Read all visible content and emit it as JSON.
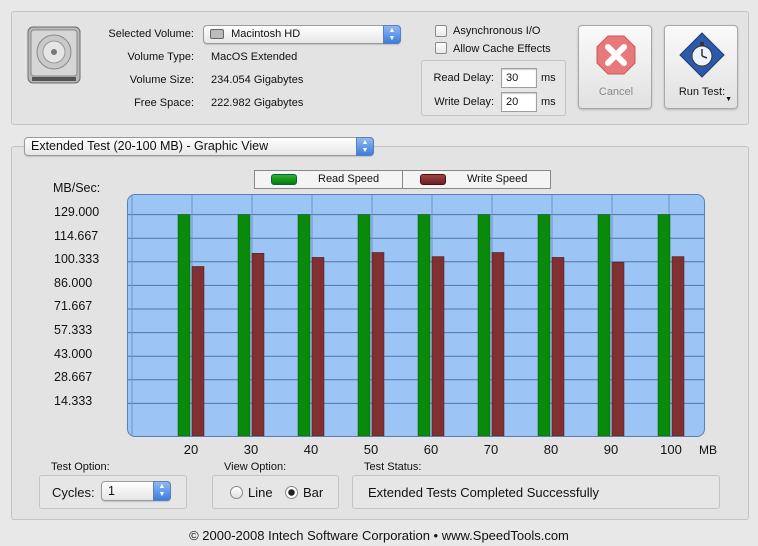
{
  "volume": {
    "selected_label": "Selected Volume:",
    "selected_value": "Macintosh HD",
    "type_label": "Volume Type:",
    "type_value": "MacOS Extended",
    "size_label": "Volume Size:",
    "size_value": "234.054 Gigabytes",
    "free_label": "Free Space:",
    "free_value": "222.982 Gigabytes"
  },
  "options": {
    "async_label": "Asynchronous I/O",
    "cache_label": "Allow Cache Effects",
    "read_delay_label": "Read Delay:",
    "read_delay_value": "30",
    "write_delay_label": "Write Delay:",
    "write_delay_value": "20",
    "ms": "ms"
  },
  "buttons": {
    "cancel": "Cancel",
    "run_test": "Run Test:"
  },
  "test_selector": "Extended Test (20-100 MB) - Graphic View",
  "legend": {
    "read": "Read Speed",
    "write": "Write Speed",
    "read_color": "#0a8a0a",
    "write_color": "#803030"
  },
  "chart_data": {
    "type": "bar",
    "ylabel": "MB/Sec:",
    "xunit": "MB",
    "categories": [
      "20",
      "30",
      "40",
      "50",
      "60",
      "70",
      "80",
      "90",
      "100"
    ],
    "yticks": [
      "129.000",
      "114.667",
      "100.333",
      "86.000",
      "71.667",
      "57.333",
      "43.000",
      "28.667",
      "14.333"
    ],
    "ylim": [
      0,
      143.333
    ],
    "series": [
      {
        "name": "Read Speed",
        "values": [
          129,
          129,
          129,
          129,
          129,
          129,
          129,
          129,
          129
        ]
      },
      {
        "name": "Write Speed",
        "values": [
          97.5,
          105.5,
          103,
          106,
          103.5,
          106,
          103,
          100,
          103.5
        ]
      }
    ]
  },
  "bottom": {
    "test_option_label": "Test Option:",
    "cycles_label": "Cycles:",
    "cycles_value": "1",
    "view_option_label": "View Option:",
    "line_label": "Line",
    "bar_label": "Bar",
    "status_label": "Test Status:",
    "status_value": "Extended Tests Completed Successfully"
  },
  "footer": "© 2000-2008 Intech Software Corporation • www.SpeedTools.com"
}
